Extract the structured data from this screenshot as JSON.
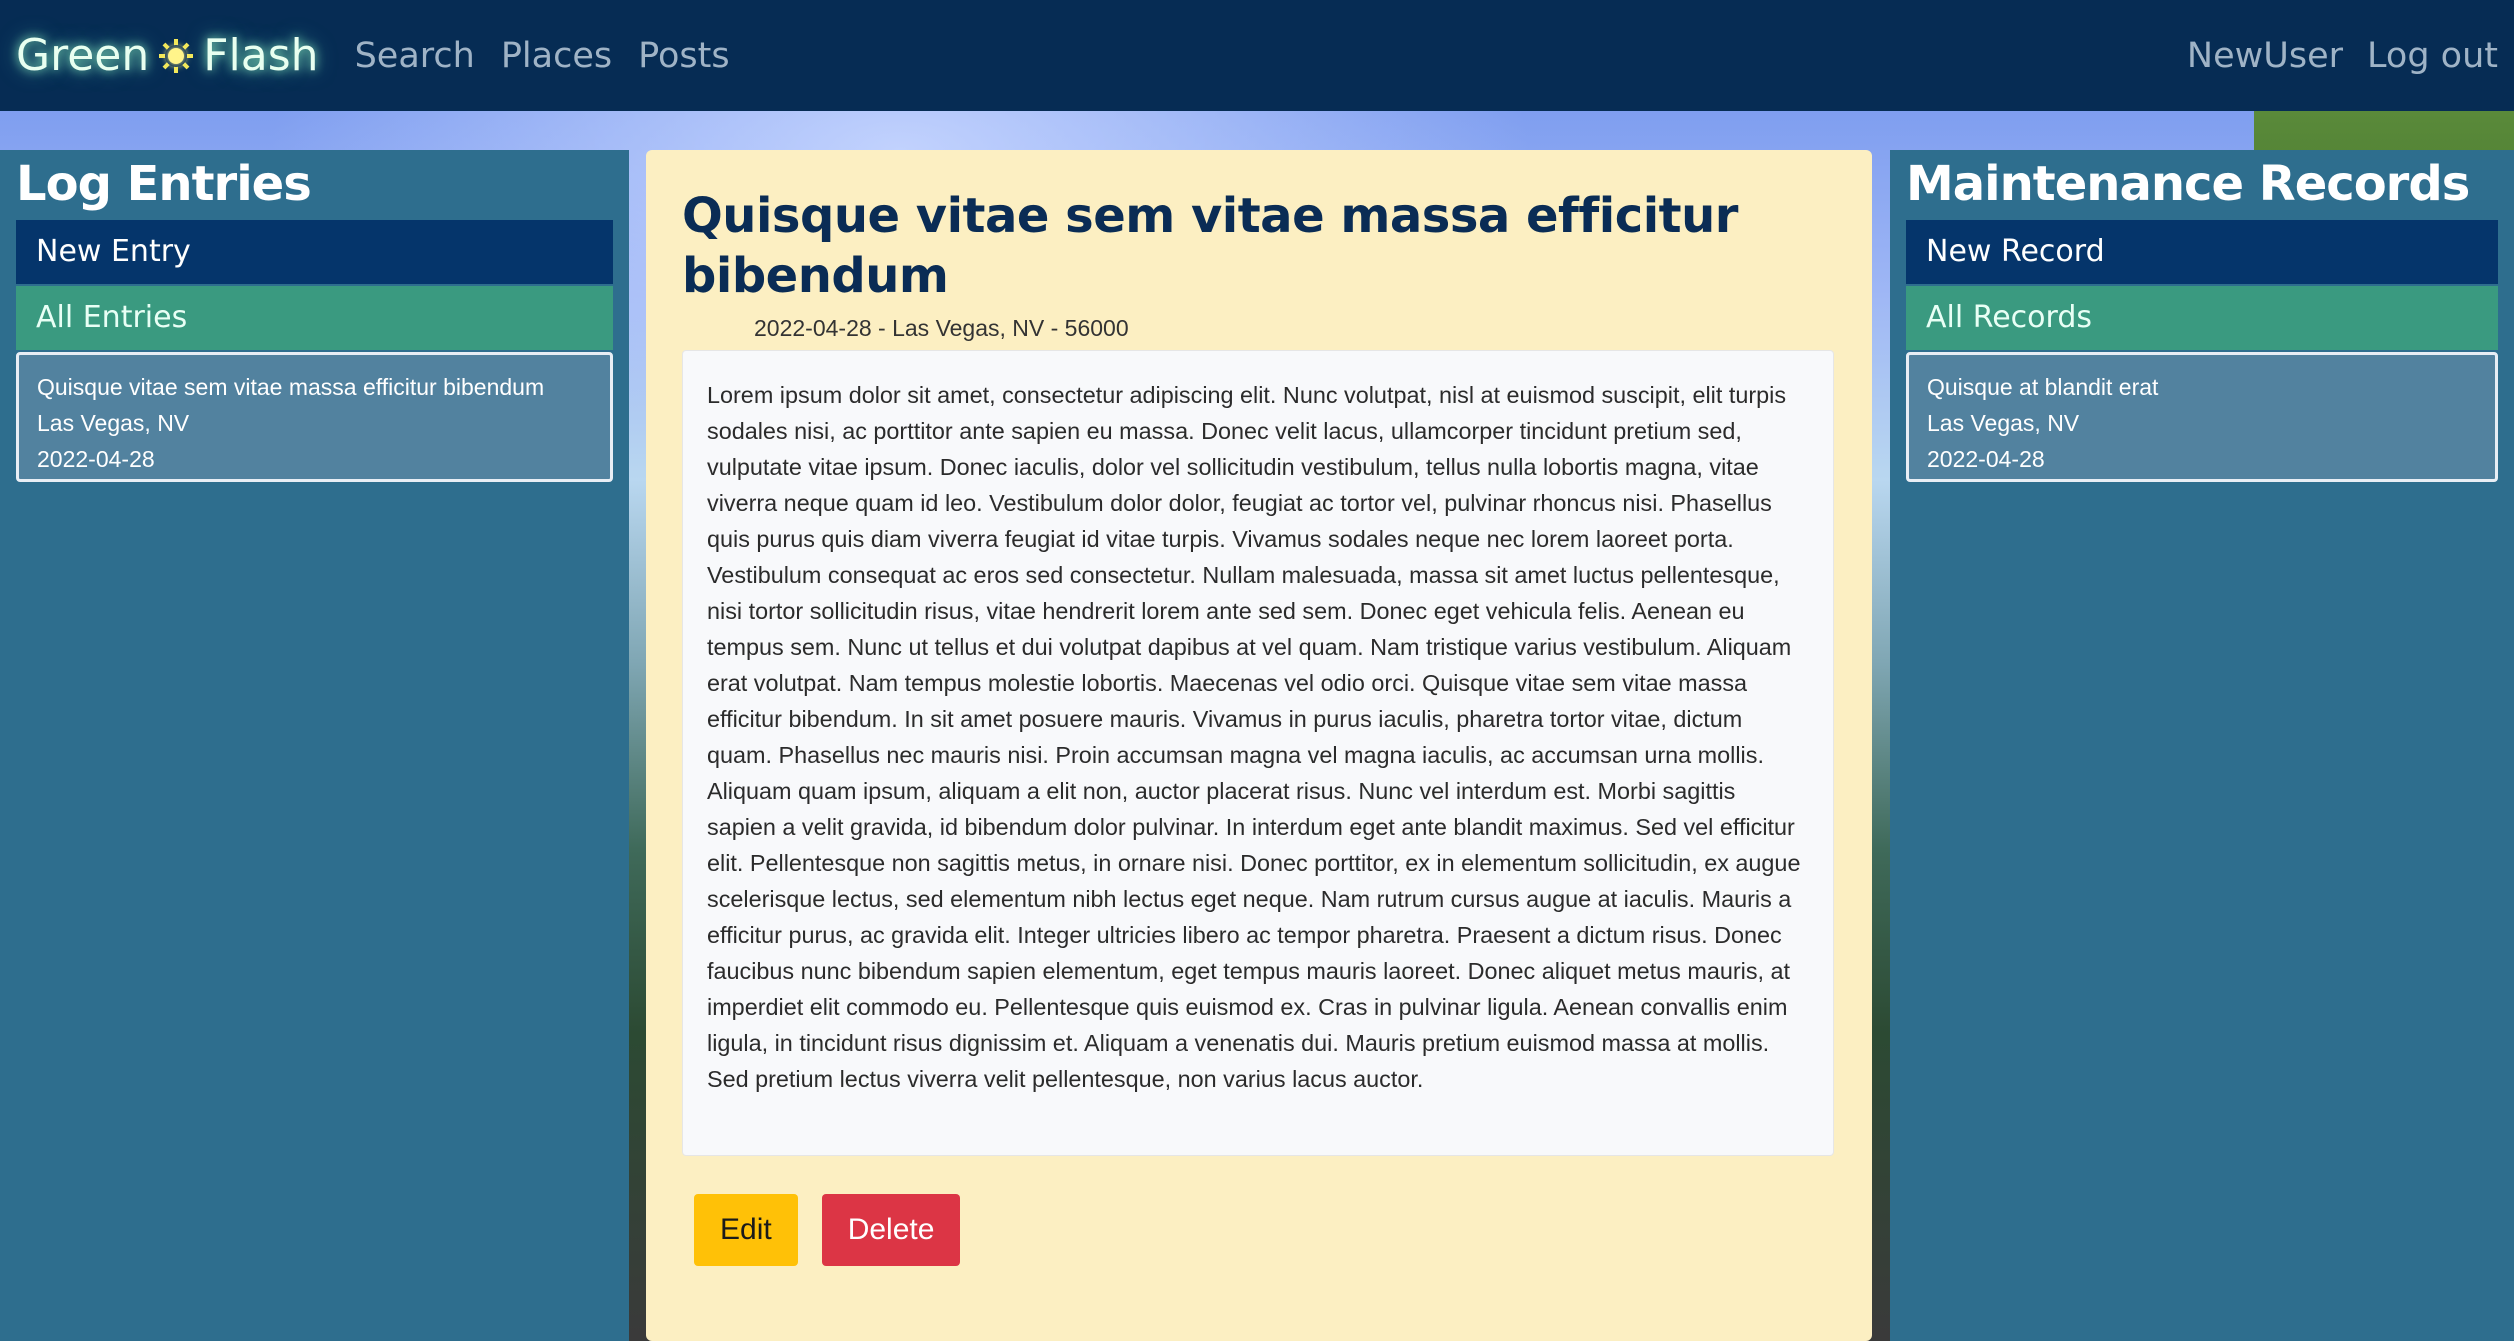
{
  "navbar": {
    "brand_left": "Green",
    "brand_right": "Flash",
    "brand_icon": "sun-icon",
    "links": [
      "Search",
      "Places",
      "Posts"
    ],
    "user": "NewUser",
    "logout": "Log out"
  },
  "log_panel": {
    "title": "Log Entries",
    "new_label": "New Entry",
    "all_label": "All Entries",
    "entries": [
      {
        "title": "Quisque vitae sem vitae massa efficitur bibendum",
        "place": "Las Vegas, NV",
        "date": "2022-04-28"
      }
    ]
  },
  "maintenance_panel": {
    "title": "Maintenance Records",
    "new_label": "New Record",
    "all_label": "All Records",
    "records": [
      {
        "title": "Quisque at blandit erat",
        "place": "Las Vegas, NV",
        "date": "2022-04-28"
      }
    ]
  },
  "post": {
    "title": "Quisque vitae sem vitae massa efficitur bibendum",
    "meta": "2022-04-28 - Las Vegas, NV - 56000",
    "body": "Lorem ipsum dolor sit amet, consectetur adipiscing elit. Nunc volutpat, nisl at euismod suscipit, elit turpis sodales nisi, ac porttitor ante sapien eu massa. Donec velit lacus, ullamcorper tincidunt pretium sed, vulputate vitae ipsum. Donec iaculis, dolor vel sollicitudin vestibulum, tellus nulla lobortis magna, vitae viverra neque quam id leo. Vestibulum dolor dolor, feugiat ac tortor vel, pulvinar rhoncus nisi. Phasellus quis purus quis diam viverra feugiat id vitae turpis. Vivamus sodales neque nec lorem laoreet porta. Vestibulum consequat ac eros sed consectetur. Nullam malesuada, massa sit amet luctus pellentesque, nisi tortor sollicitudin risus, vitae hendrerit lorem ante sed sem. Donec eget vehicula felis. Aenean eu tempus sem. Nunc ut tellus et dui volutpat dapibus at vel quam. Nam tristique varius vestibulum. Aliquam erat volutpat. Nam tempus molestie lobortis. Maecenas vel odio orci. Quisque vitae sem vitae massa efficitur bibendum. In sit amet posuere mauris. Vivamus in purus iaculis, pharetra tortor vitae, dictum quam. Phasellus nec mauris nisi. Proin accumsan magna vel magna iaculis, ac accumsan urna mollis. Aliquam quam ipsum, aliquam a elit non, auctor placerat risus. Nunc vel interdum est. Morbi sagittis sapien a velit gravida, id bibendum dolor pulvinar. In interdum eget ante blandit maximus. Sed vel efficitur elit. Pellentesque non sagittis metus, in ornare nisi. Donec porttitor, ex in elementum sollicitudin, ex augue scelerisque lectus, sed elementum nibh lectus eget neque. Nam rutrum cursus augue at iaculis. Mauris a efficitur purus, ac gravida elit. Integer ultricies libero ac tempor pharetra. Praesent a dictum risus. Donec faucibus nunc bibendum sapien elementum, eget tempus mauris laoreet. Donec aliquet metus mauris, at imperdiet elit commodo eu. Pellentesque quis euismod ex. Cras in pulvinar ligula. Aenean convallis enim ligula, in tincidunt risus dignissim et. Aliquam a venenatis dui. Mauris pretium euismod massa at mollis. Sed pretium lectus viverra velit pellentesque, non varius lacus auctor.",
    "edit_label": "Edit",
    "delete_label": "Delete"
  },
  "colors": {
    "navbar": "#062c54",
    "panel": "#2e6e8e",
    "new_button": "#05356b",
    "all_button": "#3a9a80",
    "main": "#fcefc2",
    "edit": "#ffc107",
    "delete": "#dc3545"
  }
}
